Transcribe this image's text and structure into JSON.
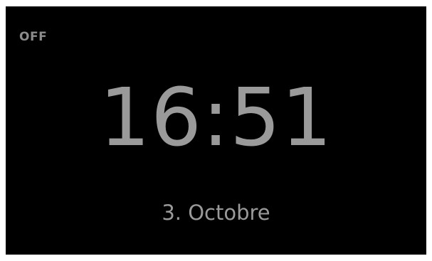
{
  "display": {
    "status": "OFF",
    "time": "16:51",
    "date": "3. Octobre"
  },
  "colors": {
    "background": "#000000",
    "text": "#9a9a9a",
    "frame": "#ffffff"
  }
}
